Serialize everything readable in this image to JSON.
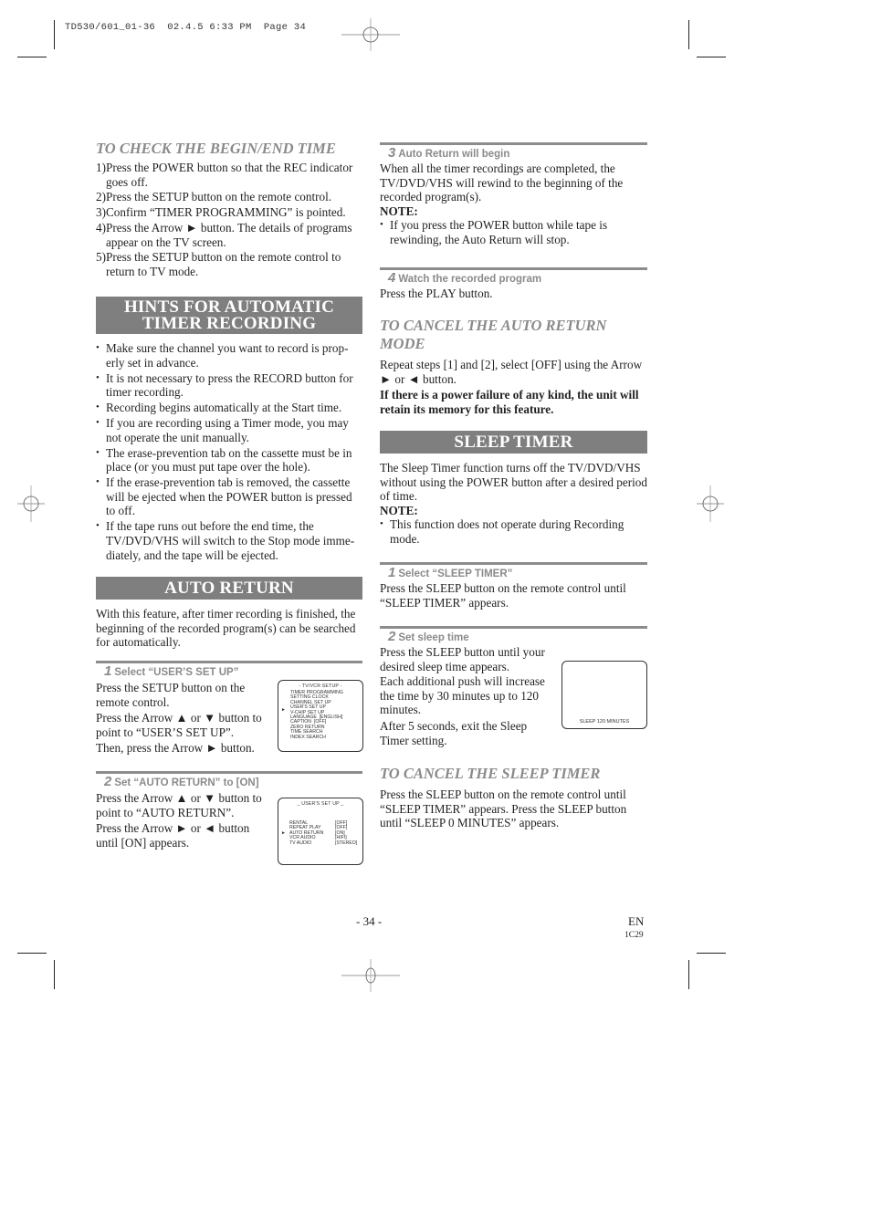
{
  "print_slug": "TD530/601_01-36  02.4.5 6:33 PM  Page 34",
  "left_column": {
    "check_time": {
      "heading": "TO CHECK THE BEGIN/END TIME",
      "steps": [
        "1)Press the POWER button so that the REC indicator goes off.",
        "2)Press the SETUP button on the remote control.",
        "3)Confirm “TIMER PROGRAMMING” is pointed.",
        "4)Press the Arrow ► button. The details of programs appear on the TV screen.",
        "5)Press the SETUP button on the remote control to return to TV mode."
      ]
    },
    "hints": {
      "banner_line1": "HINTS FOR AUTOMATIC",
      "banner_line2": "TIMER RECORDING",
      "bullets": [
        "Make sure the channel you want to record is prop-erly set in advance.",
        "It is not necessary to press the RECORD button for timer recording.",
        "Recording begins automatically at the Start time.",
        "If you are recording using a Timer mode, you may not operate the unit manually.",
        "The erase-prevention tab on the cassette must be in place (or you must put tape over the hole).",
        "If the erase-prevention tab is removed, the cassette will be ejected when the POWER button is pressed to off.",
        "If the tape runs out before the end time, the TV/DVD/VHS will switch to the Stop mode imme-diately, and the tape will be ejected."
      ]
    },
    "auto_return": {
      "banner": "AUTO RETURN",
      "intro": "With this feature, after timer recording is finished, the beginning of the recorded program(s) can be searched for automatically.",
      "step1": {
        "number": "1",
        "title": "Select “USER’S SET UP”",
        "para1": "Press the SETUP button on the remote control.",
        "para2": "Press the Arrow ▲ or ▼ button to point to “USER’S SET UP”.",
        "para3": "Then, press the Arrow ► button.",
        "screen": {
          "title": "- TV/VCR SETUP -",
          "pointer": "►",
          "items": [
            "TIMER PROGRAMMING",
            "SETTING CLOCK",
            "CHANNEL SET UP",
            "USER'S SET UP",
            "V-CHIP SET UP",
            "LANGUAGE  [ENGLISH]",
            "CAPTION  [OFF]",
            "ZERO RETURN",
            "TIME SEARCH",
            "INDEX SEARCH"
          ]
        }
      },
      "step2": {
        "number": "2",
        "title": "Set “AUTO RETURN” to [ON]",
        "para1": "Press the Arrow ▲ or ▼ button to point to “AUTO RETURN”.",
        "para2": "Press the Arrow ► or ◄ button until [ON] appears.",
        "screen": {
          "title": "_ USER'S SET UP _",
          "pointer": "►",
          "rows": [
            {
              "label": "RENTAL",
              "value": "[OFF]"
            },
            {
              "label": "REPEAT PLAY",
              "value": "[OFF]"
            },
            {
              "label": "AUTO RETURN",
              "value": "[ON]"
            },
            {
              "label": "VCR AUDIO",
              "value": "[HIFI]"
            },
            {
              "label": "TV AUDIO",
              "value": "[STEREO]"
            }
          ]
        }
      }
    }
  },
  "right_column": {
    "step3": {
      "number": "3",
      "title": "Auto Return will begin",
      "para": "When all the timer recordings are completed, the TV/DVD/VHS will rewind to the beginning of the recorded program(s).",
      "note_label": "NOTE:",
      "note_bullet": "If you press the POWER button while tape is rewinding, the Auto Return will stop."
    },
    "step4": {
      "number": "4",
      "title": "Watch the recorded program",
      "para": "Press the PLAY button."
    },
    "cancel_auto_return": {
      "heading_line1": "TO CANCEL THE AUTO RETURN",
      "heading_line2": "MODE",
      "para": "Repeat steps [1] and [2], select [OFF] using the Arrow ► or ◄ button.",
      "bold": "If there is a power failure of any kind, the unit will retain its memory for this feature."
    },
    "sleep_timer": {
      "banner": "SLEEP TIMER",
      "intro": "The Sleep Timer function turns off the TV/DVD/VHS without using the POWER button after a desired  period of time.",
      "note_label": "NOTE:",
      "note_bullet": "This function does not operate during Recording mode.",
      "step1": {
        "number": "1",
        "title": "Select “SLEEP TIMER”",
        "para": "Press the SLEEP button on the remote control until “SLEEP TIMER” appears."
      },
      "step2": {
        "number": "2",
        "title": "Set sleep time",
        "para1": "Press the SLEEP button until your desired sleep time appears.",
        "para2": "Each additional push will increase the time by 30 minutes up to 120 minutes.",
        "para3": "After 5 seconds, exit the Sleep Timer setting.",
        "screen_text": "SLEEP 120 MINUTES"
      }
    },
    "cancel_sleep": {
      "heading": "TO CANCEL THE SLEEP TIMER",
      "para": "Press the SLEEP button on the remote control until “SLEEP TIMER” appears. Press the SLEEP button until “SLEEP 0 MINUTES” appears."
    }
  },
  "footer": {
    "page_number": "- 34 -",
    "language": "EN",
    "code": "1C29"
  }
}
